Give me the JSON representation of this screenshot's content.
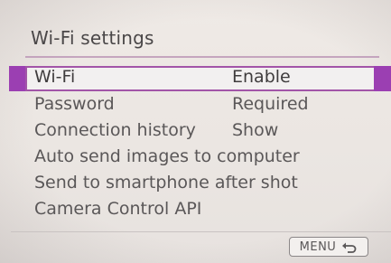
{
  "screen": {
    "title": "Wi-Fi settings"
  },
  "menu": {
    "items": [
      {
        "label": "Wi-Fi",
        "value": "Enable",
        "selected": true
      },
      {
        "label": "Password",
        "value": "Required"
      },
      {
        "label": "Connection history",
        "value": "Show"
      },
      {
        "label": "Auto send images to computer",
        "value": ""
      },
      {
        "label": "Send to smartphone after shot",
        "value": ""
      },
      {
        "label": "Camera Control API",
        "value": ""
      }
    ]
  },
  "footer": {
    "menu_button_label": "MENU",
    "back_icon": "return-arrow-icon"
  },
  "colors": {
    "selection_accent": "#9b3fb2",
    "selection_border": "#a255a8",
    "background": "#ece7e3",
    "text": "#5a5758"
  }
}
